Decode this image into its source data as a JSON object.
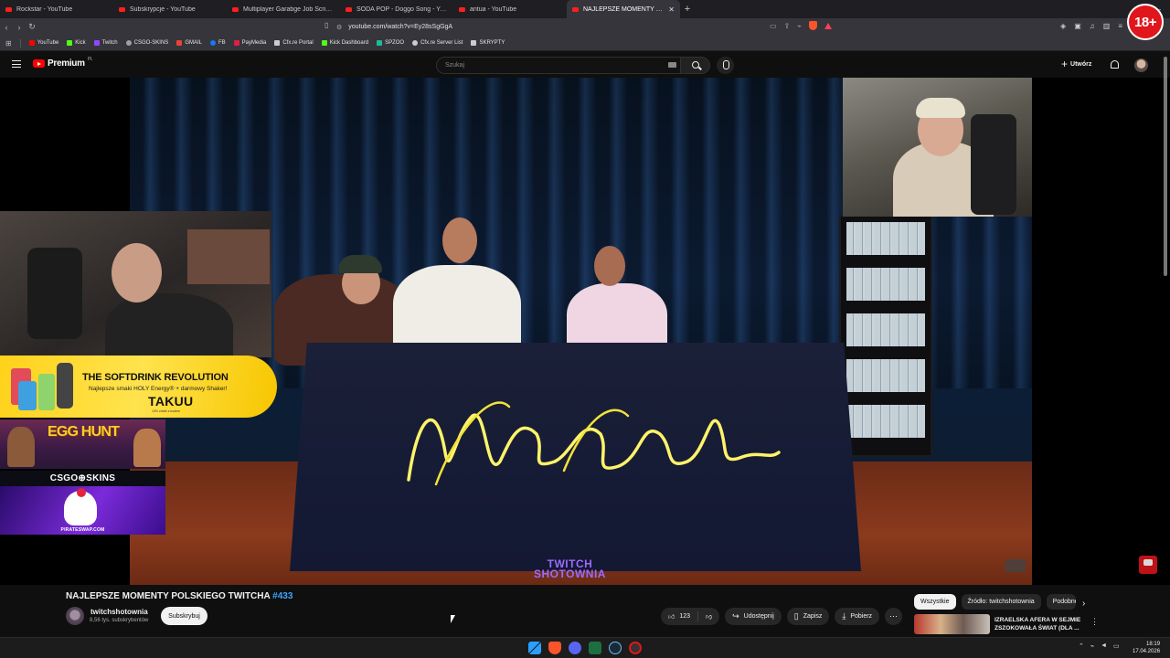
{
  "browser": {
    "tabs": [
      {
        "label": "Rockstar - YouTube",
        "active": false
      },
      {
        "label": "Subskrypcje - YouTube",
        "active": false
      },
      {
        "label": "Multiplayer Garabge Job Script + Mi",
        "active": false
      },
      {
        "label": "SODA POP - Doggo Song - YouTube",
        "active": false
      },
      {
        "label": "antua - YouTube",
        "active": false
      },
      {
        "label": "NAJLEPSZE MOMENTY POLSKI",
        "active": true
      }
    ],
    "url": "youtube.com/watch?v=Ey28sSgGgA",
    "bookmarks": [
      {
        "label": "YouTube",
        "color": "#ff0000"
      },
      {
        "label": "Kick",
        "color": "#53fc18"
      },
      {
        "label": "Twitch",
        "color": "#9146ff"
      },
      {
        "label": "CSGO-SKINS",
        "color": "#9aa0a6"
      },
      {
        "label": "GMAIL",
        "color": "#ea4335"
      },
      {
        "label": "FB",
        "color": "#1877f2"
      },
      {
        "label": "PayMedia",
        "color": "#e11d48"
      },
      {
        "label": "Cfx.re Portal",
        "color": "#cccccc"
      },
      {
        "label": "Kick Dashboard",
        "color": "#53fc18"
      },
      {
        "label": "SPZOO",
        "color": "#1abc9c"
      },
      {
        "label": "Cfx.re Server List",
        "color": "#cccccc"
      },
      {
        "label": "SKRYPTY",
        "color": "#cccccc"
      }
    ],
    "age_badge": "18+"
  },
  "yt_header": {
    "logo_text": "Premium",
    "region": "PL",
    "search_placeholder": "Szukaj",
    "create_label": "Utwórz"
  },
  "video": {
    "watermark_line1": "TWITCH",
    "watermark_line2": "SHOTOWNIA"
  },
  "overlays": {
    "promo_title": "THE SOFTDRINK REVOLUTION",
    "promo_sub": "Najlepsze smaki HOLY Energy® + darmowy Shaker!",
    "promo_brand": "TAKUU",
    "promo_small": "10% zniżki z kodem",
    "egghunt_text": "EGG HUNT",
    "csgo_label": "CSGO⊕SKINS",
    "pirate_url": "PIRATESWAP.COM"
  },
  "watch": {
    "title": "NAJLEPSZE MOMENTY POLSKIEGO TWITCHA",
    "title_tag": "#433",
    "channel_name": "twitchshotownia",
    "subscribers": "8,56 tys. subskrybentów",
    "subscribe_label": "Subskrybuj",
    "likes": "123",
    "share_label": "Udostępnij",
    "save_label": "Zapisz",
    "download_label": "Pobierz"
  },
  "sidebar": {
    "chips": [
      "Wszystkie",
      "Źródło: twitchshotownia",
      "Podobne"
    ],
    "rec_title": "IZRAELSKA AFERA W SEJMIE ZSZOKOWAŁA ŚWIAT (DLA ..."
  },
  "taskbar": {
    "time": "18:19",
    "date": "17.04.2026"
  }
}
